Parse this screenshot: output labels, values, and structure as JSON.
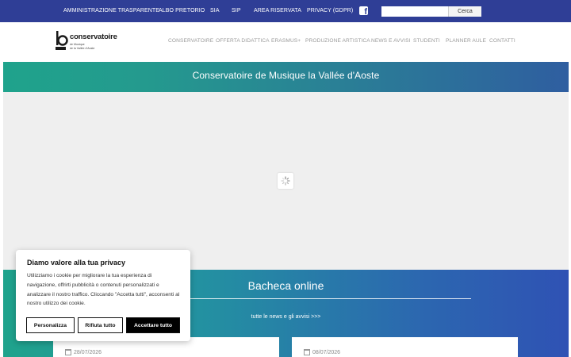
{
  "topbar": {
    "links": [
      "AMMINISTRAZIONE TRASPARENTE",
      "ALBO PRETORIO",
      "SIA",
      "SIP",
      "AREA RISERVATA",
      "PRIVACY (GDPR)"
    ],
    "search_placeholder": "",
    "search_button": "Cerca",
    "social_icon": "facebook-icon"
  },
  "logo": {
    "name": "conservatoire",
    "subtitle_line1": "de Musique",
    "subtitle_line2": "de la Vallée d'Aoste"
  },
  "nav": {
    "items": [
      "CONSERVATOIRE",
      "OFFERTA DIDATTICA",
      "ERASMUS+",
      "PRODUZIONE ARTISTICA",
      "NEWS E AVVISI",
      "STUDENTI",
      "PLANNER AULE",
      "CONTATTI"
    ]
  },
  "hero": {
    "title": "Conservatoire de Musique la Vallée d'Aoste"
  },
  "bacheca": {
    "title": "Bacheca online",
    "link": "tutte le news e gli avvisi >>>",
    "cards": [
      {
        "date": "28/07/2026"
      },
      {
        "date": "08/07/2026"
      }
    ]
  },
  "cookie": {
    "title": "Diamo valore alla tua privacy",
    "text": "Utilizziamo i cookie per migliorare la tua esperienza di navigazione, offrirti pubblicità o contenuti personalizzati e analizzare il nostro traffico. Cliccando \"Accetta tutti\", acconsenti al nostro utilizzo dei cookie.",
    "customize": "Personalizza",
    "reject": "Rifiuta tutto",
    "accept": "Accettare tutto"
  },
  "colors": {
    "topbar": "#2f3e96",
    "gradient_start": "#1fa38c",
    "gradient_end": "#2f52b4"
  }
}
